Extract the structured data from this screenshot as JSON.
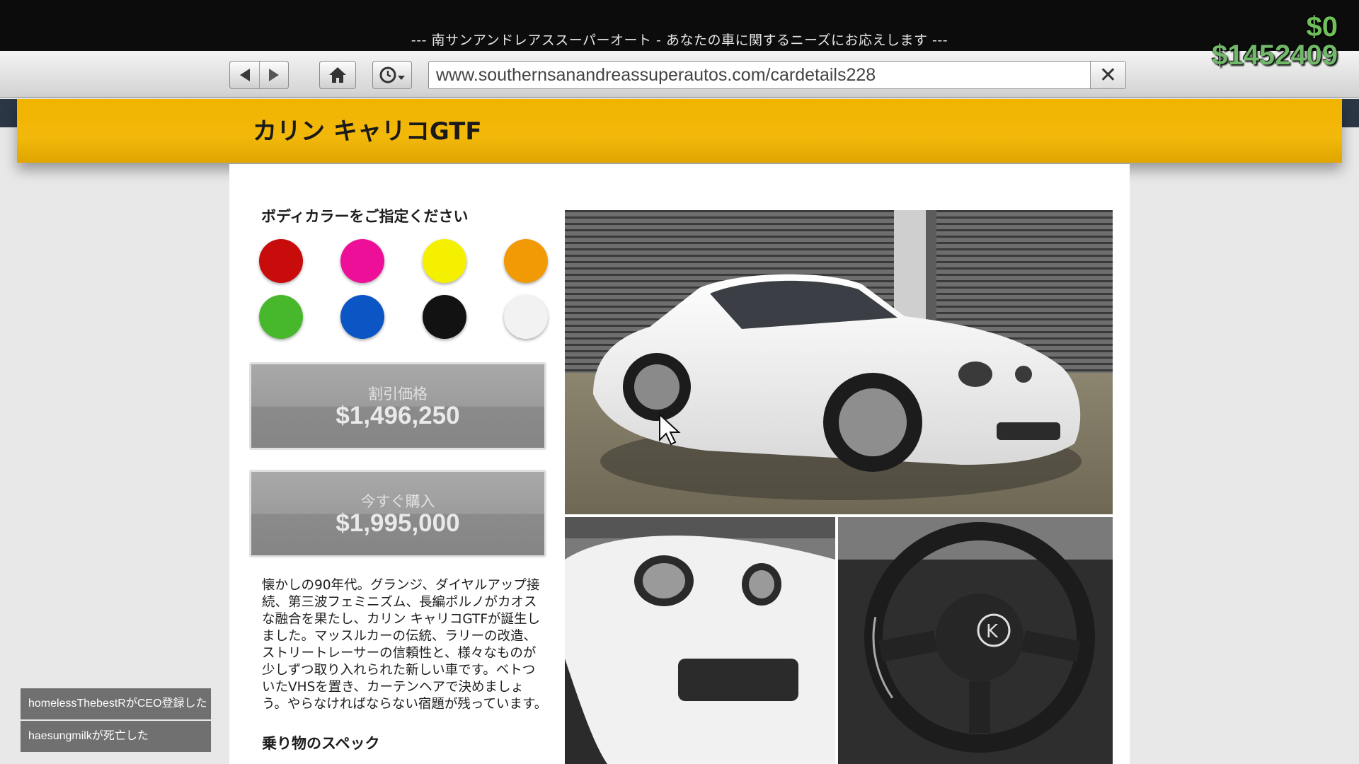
{
  "header": {
    "tagline": "--- 南サンアンドレアススーパーオート - あなたの車に関するニーズにお応えします ---"
  },
  "browser": {
    "back_icon": "back-arrow-icon",
    "forward_icon": "forward-arrow-icon",
    "home_icon": "home-icon",
    "history_icon": "history-clock-icon",
    "url": "www.southernsanandreassuperautos.com/cardetails228",
    "close_icon": "close-x-icon"
  },
  "hud": {
    "cash": "$0",
    "bank": "$1452409"
  },
  "vehicle": {
    "title": "カリン キャリコGTF"
  },
  "color_picker": {
    "title": "ボディカラーをご指定ください",
    "swatches": [
      "#c80b0b",
      "#ee0f98",
      "#f5f000",
      "#f19a06",
      "#47b82c",
      "#0b55c4",
      "#121212",
      "#f2f2f2"
    ]
  },
  "pricing": {
    "discount_label": "割引価格",
    "discount_price": "$1,496,250",
    "buy_label": "今すぐ購入",
    "buy_price": "$1,995,000"
  },
  "description": "懐かしの90年代。グランジ、ダイヤルアップ接続、第三波フェミニズム、長編ポルノがカオスな融合を果たし、カリン キャリコGTFが誕生しました。マッスルカーの伝統、ラリーの改造、ストリートレーサーの信頼性と、様々なものが少しずつ取り入れられた新しい車です。ベトついたVHSを置き、カーテンヘアで決めましょう。やらなければならない宿題が残っています。",
  "specs": {
    "title": "乗り物のスペック"
  },
  "notifications": [
    "homelessThebestRがCEO登録した",
    "haesungmilkが死亡した"
  ]
}
